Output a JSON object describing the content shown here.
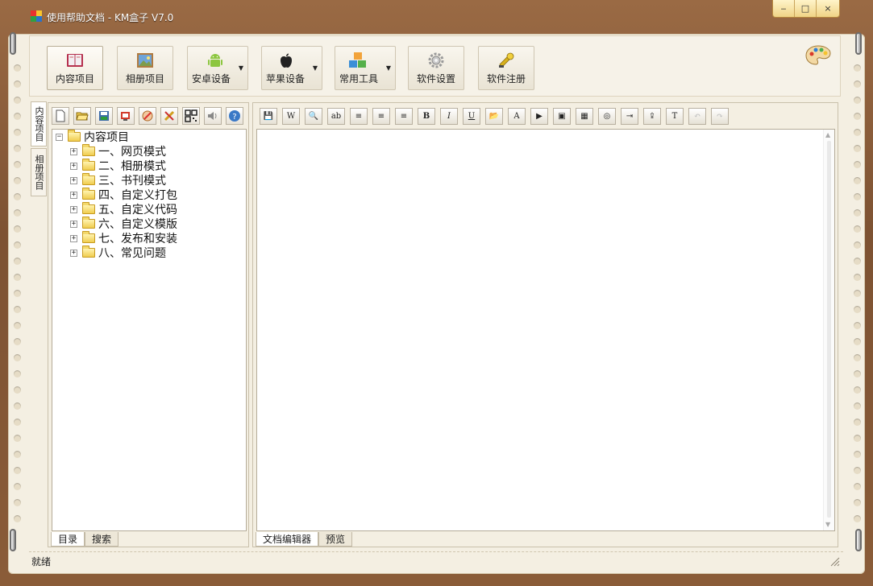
{
  "window": {
    "title": "使用帮助文档 - KM盒子 V7.0",
    "controls": {
      "minimize": "‒",
      "maximize": "□",
      "close": "×"
    }
  },
  "main_toolbar": {
    "buttons": [
      {
        "label": "内容项目",
        "icon": "book-icon",
        "dropdown": false
      },
      {
        "label": "相册项目",
        "icon": "picture-icon",
        "dropdown": false
      },
      {
        "label": "安卓设备",
        "icon": "android-icon",
        "dropdown": true
      },
      {
        "label": "苹果设备",
        "icon": "apple-icon",
        "dropdown": true
      },
      {
        "label": "常用工具",
        "icon": "blocks-icon",
        "dropdown": true
      },
      {
        "label": "软件设置",
        "icon": "gear-icon",
        "dropdown": false
      },
      {
        "label": "软件注册",
        "icon": "key-icon",
        "dropdown": false
      }
    ],
    "dropdown_glyph": "▼"
  },
  "side_tabs": {
    "content": "内容项目",
    "album": "相册项目"
  },
  "left_panel": {
    "toolbar_icons": [
      "new-file-icon",
      "open-folder-icon",
      "save-icon",
      "export-icon",
      "edit-icon",
      "tools-icon",
      "qrcode-icon",
      "sound-icon",
      "help-icon"
    ],
    "tree": {
      "root": "内容项目",
      "items": [
        "一、网页模式",
        "二、相册模式",
        "三、书刊模式",
        "四、自定义打包",
        "五、自定义代码",
        "六、自定义模版",
        "七、发布和安装",
        "八、常见问题"
      ],
      "collapse_glyph": "−",
      "expand_glyph": "+"
    },
    "tabs": [
      "目录",
      "搜索"
    ]
  },
  "right_panel": {
    "toolbar": [
      {
        "name": "save-icon",
        "glyph": "💾"
      },
      {
        "name": "word-icon",
        "glyph": "W"
      },
      {
        "name": "find-icon",
        "glyph": "🔍"
      },
      {
        "name": "spellcheck-icon",
        "glyph": "ab"
      },
      {
        "name": "align-left-icon",
        "glyph": "≡"
      },
      {
        "name": "align-center-icon",
        "glyph": "≡"
      },
      {
        "name": "align-right-icon",
        "glyph": "≡"
      },
      {
        "name": "bold-icon",
        "glyph": "B"
      },
      {
        "name": "italic-icon",
        "glyph": "I"
      },
      {
        "name": "underline-icon",
        "glyph": "U"
      },
      {
        "name": "open-icon",
        "glyph": "📂"
      },
      {
        "name": "font-color-icon",
        "glyph": "A"
      },
      {
        "name": "video-icon",
        "glyph": "▶"
      },
      {
        "name": "image-icon",
        "glyph": "▣"
      },
      {
        "name": "table-icon",
        "glyph": "▦"
      },
      {
        "name": "link-icon",
        "glyph": "◎"
      },
      {
        "name": "import-icon",
        "glyph": "⇥"
      },
      {
        "name": "export-icon",
        "glyph": "⇪"
      },
      {
        "name": "template-icon",
        "glyph": "T"
      },
      {
        "name": "undo-icon",
        "glyph": "↶",
        "disabled": true
      },
      {
        "name": "redo-icon",
        "glyph": "↷",
        "disabled": true
      }
    ],
    "tabs": [
      "文档编辑器",
      "预览"
    ]
  },
  "status": {
    "text": "就绪"
  },
  "colors": {
    "wood": "#8a5a36",
    "paper": "#f4efe2",
    "title_text": "#ffffff"
  }
}
